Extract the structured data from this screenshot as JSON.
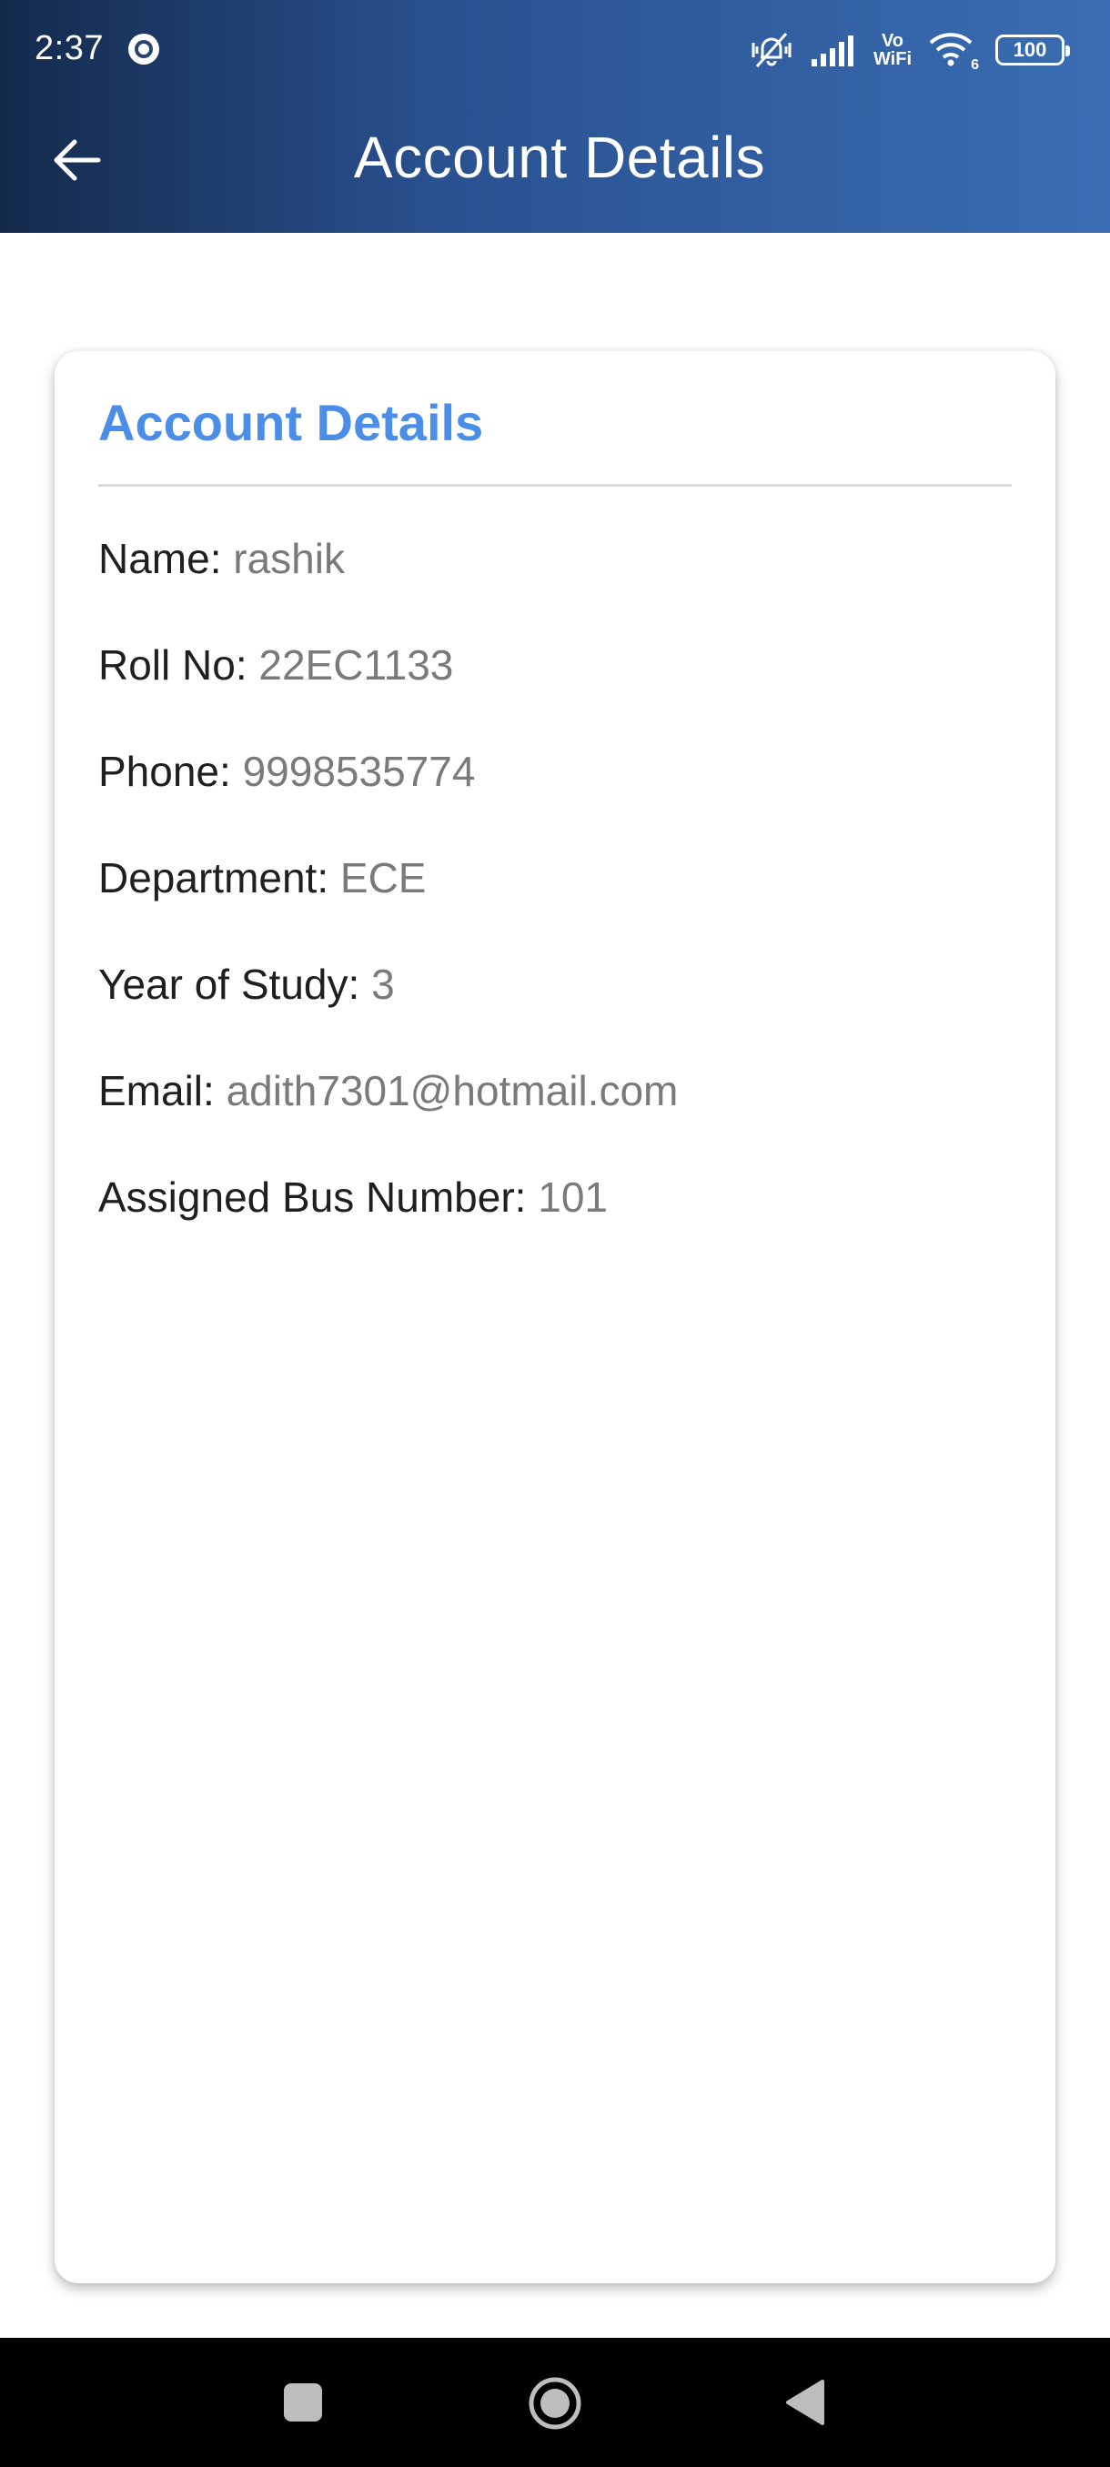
{
  "status_bar": {
    "time": "2:37",
    "vowifi_top": "Vo",
    "vowifi_bottom": "WiFi",
    "wifi_badge": "6",
    "battery": "100",
    "icons": [
      "radio-record-icon",
      "vibrate-mute-icon",
      "signal-icon",
      "vowifi-icon",
      "wifi-icon",
      "battery-icon"
    ]
  },
  "app_bar": {
    "title": "Account Details",
    "back_icon": "arrow-left-icon"
  },
  "card": {
    "title": "Account Details",
    "fields": [
      {
        "label": "Name:",
        "value": "rashik"
      },
      {
        "label": "Roll No:",
        "value": "22EC1133"
      },
      {
        "label": "Phone:",
        "value": "9998535774"
      },
      {
        "label": "Department:",
        "value": "ECE"
      },
      {
        "label": "Year of Study:",
        "value": "3"
      },
      {
        "label": "Email:",
        "value": "adith7301@hotmail.com"
      },
      {
        "label": "Assigned Bus Number:",
        "value": "101"
      }
    ]
  },
  "nav_bar": {
    "buttons": [
      "recents-square-icon",
      "home-circle-icon",
      "back-triangle-icon"
    ]
  },
  "colors": {
    "header_dark": "#142a4c",
    "header_light": "#3a6db3",
    "card_title": "#4a8ee8",
    "label": "#1f1f1f",
    "value": "#7a7a7a"
  }
}
